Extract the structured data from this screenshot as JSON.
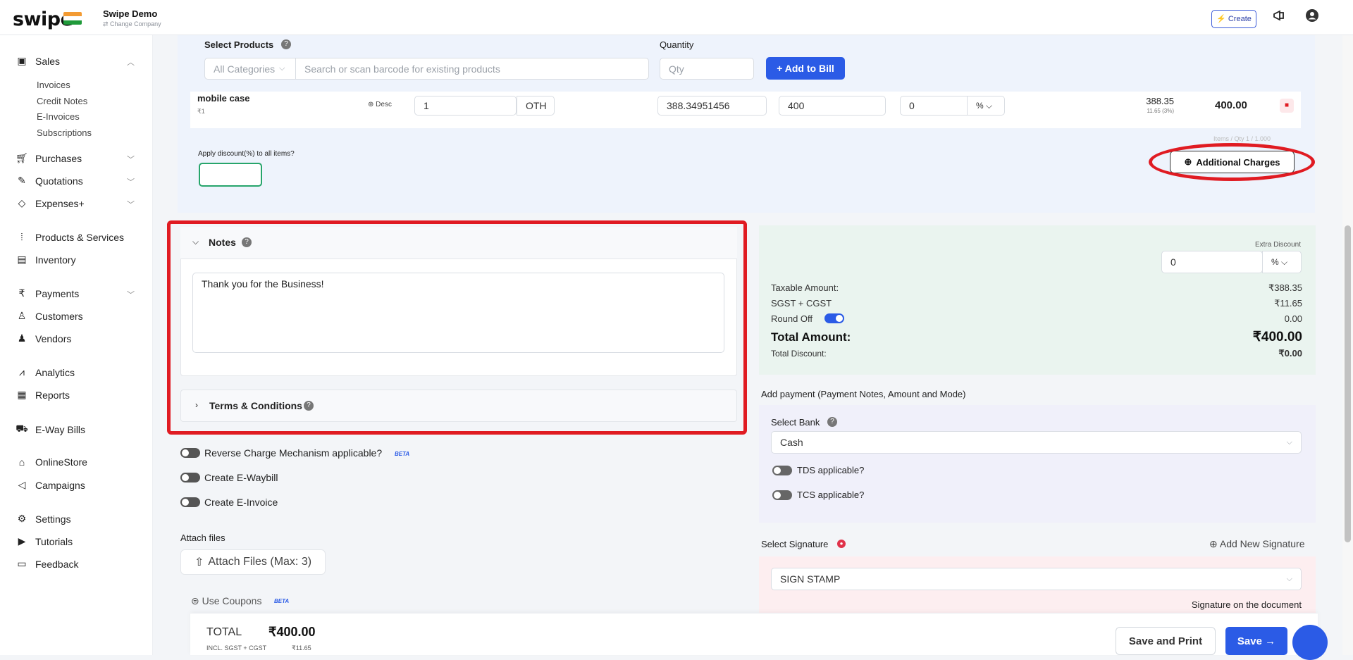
{
  "header": {
    "logo": "swipe",
    "company_name": "Swipe Demo",
    "company_sub": "⇄ Change Company",
    "create_label": "⚡ Create"
  },
  "sidebar": {
    "sales": "Sales",
    "invoices": "Invoices",
    "credit_notes": "Credit Notes",
    "e_invoices": "E-Invoices",
    "subscriptions": "Subscriptions",
    "purchases": "Purchases",
    "quotations": "Quotations",
    "expenses": "Expenses+",
    "products": "Products & Services",
    "inventory": "Inventory",
    "payments": "Payments",
    "customers": "Customers",
    "vendors": "Vendors",
    "analytics": "Analytics",
    "reports": "Reports",
    "eway": "E-Way Bills",
    "onlinestore": "OnlineStore",
    "campaigns": "Campaigns",
    "settings": "Settings",
    "tutorials": "Tutorials",
    "feedback": "Feedback"
  },
  "products": {
    "select_label": "Select Products",
    "quantity_label": "Quantity",
    "category": "All Categories",
    "search_placeholder": "Search or scan barcode for existing products",
    "qty_placeholder": "Qty",
    "add_label": "+ Add to Bill"
  },
  "item": {
    "name": "mobile case",
    "sub": "₹1",
    "desc": "Desc",
    "qty": "1",
    "unit": "OTH",
    "price": "388.34951456",
    "price_with_tax": "400",
    "discount": "0",
    "discount_type": "% ⌵",
    "net": "388.35",
    "tax_note": "11.65 (3%)",
    "total": "400.00"
  },
  "discount": {
    "label": "Apply discount(%) to all items?",
    "faint": "Items / Qty 1 / 1.000"
  },
  "additional_charges": "Additional Charges",
  "notes": {
    "title": "Notes",
    "text": "Thank you for the Business!"
  },
  "terms": {
    "title": "Terms & Conditions"
  },
  "toggles": {
    "reverse": "Reverse Charge Mechanism applicable?",
    "beta": "BETA",
    "eway": "Create E-Waybill",
    "einvoice": "Create E-Invoice"
  },
  "attach": {
    "label": "Attach files",
    "button": "Attach Files (Max: 3)"
  },
  "coupons": {
    "label": "Use Coupons",
    "beta": "BETA"
  },
  "summary": {
    "extra_discount": "Extra Discount",
    "extra_value": "0",
    "extra_type": "% ⌵",
    "taxable_label": "Taxable Amount:",
    "taxable_value": "₹388.35",
    "sgst_label": "SGST + CGST",
    "sgst_value": "₹11.65",
    "round_label": "Round Off",
    "round_value": "0.00",
    "total_label": "Total Amount:",
    "total_value": "₹400.00",
    "discount_label": "Total Discount:",
    "discount_value": "₹0.00"
  },
  "payment": {
    "title": "Add payment (Payment Notes, Amount and Mode)",
    "bank_label": "Select Bank",
    "bank_value": "Cash",
    "tds": "TDS applicable?",
    "tcs": "TCS applicable?"
  },
  "signature": {
    "label": "Select Signature",
    "add_label": "Add New Signature",
    "value": "SIGN STAMP",
    "doc_label": "Signature on the document"
  },
  "footer": {
    "total_label": "TOTAL",
    "total_value": "₹400.00",
    "tax_label": "INCL. SGST + CGST",
    "tax_value": "₹11.65",
    "save_print": "Save and Print",
    "save": "Save →"
  },
  "colors": {
    "accent": "#2b5be6",
    "highlight": "#e01b22"
  }
}
